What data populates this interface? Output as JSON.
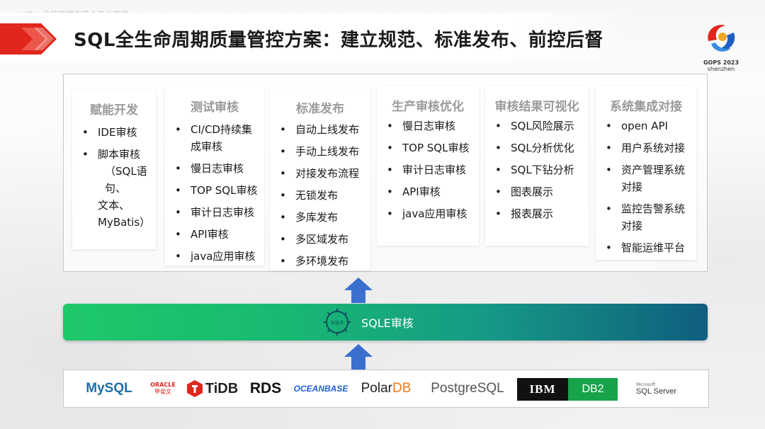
{
  "header": {
    "faint_text": "XOps全链路国内首个产业实践",
    "title": "SQL全生命周期质量管控方案：建立规范、标准发布、前控后督"
  },
  "logo": {
    "year": "GOPS 2023",
    "city": "shenzhen"
  },
  "columns": [
    {
      "title": "赋能开发",
      "items": [
        "IDE审核",
        "脚本审核",
        "（SQL语句、",
        "文本、",
        "MyBatis）"
      ]
    },
    {
      "title": "测试审核",
      "items": [
        "CI/CD持续集",
        "成审核",
        "慢日志审核",
        "TOP SQL审核",
        "审计日志审核",
        "API审核",
        "java应用审核"
      ]
    },
    {
      "title": "标准发布",
      "items": [
        "自动上线发布",
        "手动上线发布",
        "对接发布流程",
        "无锁发布",
        "多库发布",
        "多区域发布",
        "多环境发布"
      ]
    },
    {
      "title": "生产审核优化",
      "items": [
        "慢日志审核",
        "TOP SQL审核",
        "审计日志审核",
        "API审核",
        "java应用审核"
      ]
    },
    {
      "title": "审核结果可视化",
      "items": [
        "SQL风险展示",
        "SQL分析优化",
        "SQL下钻分析",
        "图表展示",
        "报表展示"
      ]
    },
    {
      "title": "系统集成对接",
      "items": [
        "open API",
        "用户系统对接",
        "资产管理系统",
        "对接",
        "监控告警系统",
        "对接",
        "智能运维平台"
      ]
    }
  ],
  "sqle": {
    "label": "SQLE审核",
    "icon_text": "SQLE"
  },
  "databases": {
    "mysql": "MySQL",
    "oracle_top": "ORACLE",
    "oracle_bottom": "甲骨文",
    "tidb": "TiDB",
    "rds": "RDS",
    "oceanbase": "OCEANBASE",
    "polardb_a": "Polar",
    "polardb_b": "DB",
    "postgresql": "PostgreSQL",
    "ibm": "IBM",
    "db2": "DB2",
    "mssql_top": "Microsoft",
    "mssql": "SQL Server"
  },
  "colors": {
    "brand_red": "#e0261b",
    "bar_green": "#1ec96a",
    "bar_teal": "#0f5e7e",
    "arrow_blue": "#3a6fcf"
  }
}
